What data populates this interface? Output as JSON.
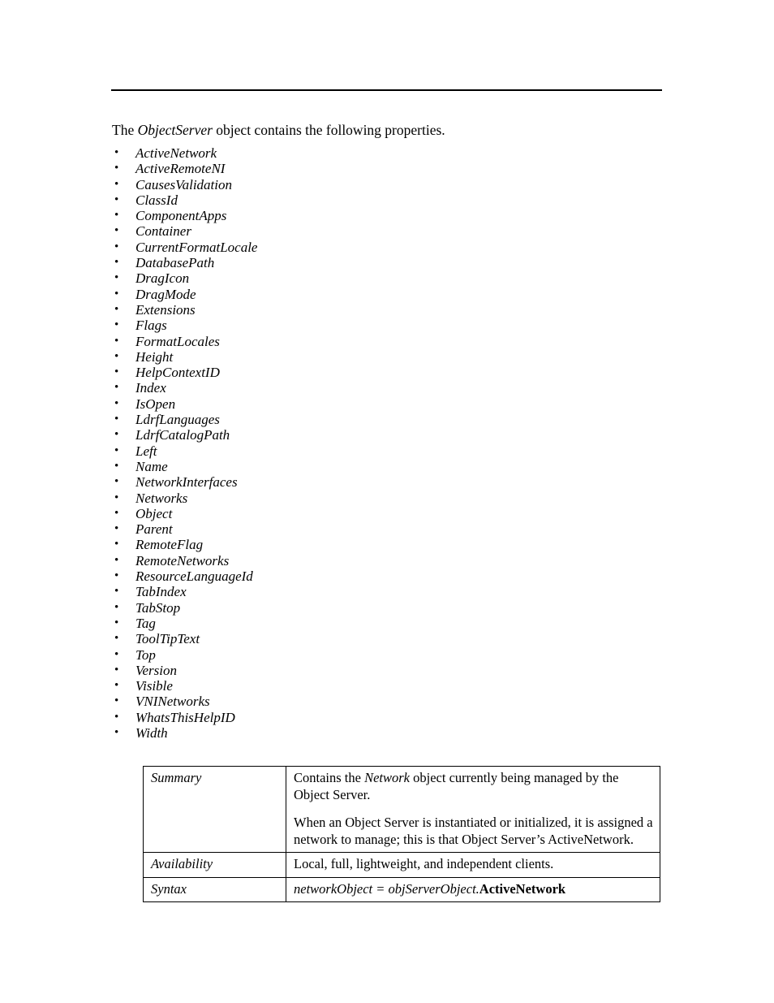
{
  "page": {
    "intro": {
      "before": "The ",
      "emphasis": "ObjectServer",
      "after": " object contains the following properties."
    },
    "properties": [
      "ActiveNetwork",
      "ActiveRemoteNI",
      "CausesValidation",
      "ClassId",
      "ComponentApps",
      "Container",
      "CurrentFormatLocale",
      "DatabasePath",
      "DragIcon",
      "DragMode",
      "Extensions",
      "Flags",
      "FormatLocales",
      "Height",
      "HelpContextID",
      "Index",
      "IsOpen",
      "LdrfLanguages",
      "LdrfCatalogPath",
      "Left",
      "Name",
      "NetworkInterfaces",
      "Networks",
      "Object",
      "Parent",
      "RemoteFlag",
      "RemoteNetworks",
      "ResourceLanguageId",
      "TabIndex",
      "TabStop",
      "Tag",
      "ToolTipText",
      "Top",
      "Version",
      "Visible",
      "VNINetworks",
      "WhatsThisHelpID",
      "Width"
    ],
    "bullet_glyph": "•",
    "detail_table": {
      "summary": {
        "label": "Summary",
        "paragraph1_before": "Contains the ",
        "paragraph1_emphasis": "Network",
        "paragraph1_after": " object currently being managed by the Object Server.",
        "paragraph2": "When an Object Server is instantiated or initialized, it is assigned a network to manage; this is that Object Server’s ActiveNetwork."
      },
      "availability": {
        "label": "Availability",
        "value": "Local, full, lightweight, and independent clients."
      },
      "syntax": {
        "label": "Syntax",
        "expression": "networkObject = objServerObject.",
        "property": "ActiveNetwork"
      }
    }
  }
}
